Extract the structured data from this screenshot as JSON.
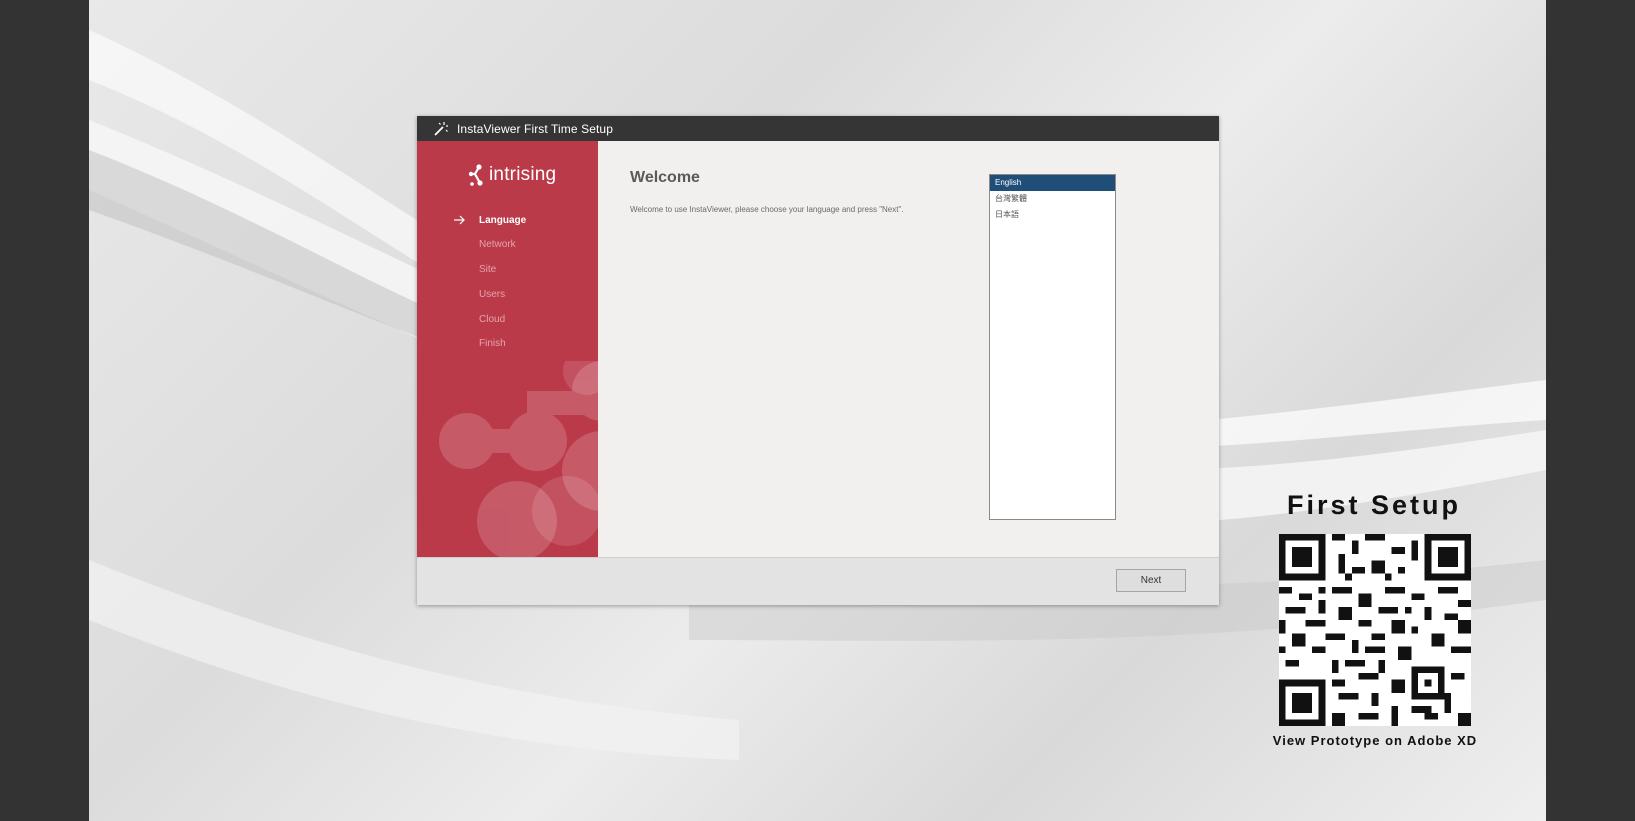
{
  "window": {
    "title": "InstaViewer First Time Setup",
    "app_icon": "magic-wand-icon"
  },
  "sidebar": {
    "brand": "intrising",
    "brand_icon": "intrising-logo-mark",
    "steps": [
      {
        "label": "Language",
        "active": true
      },
      {
        "label": "Network",
        "active": false
      },
      {
        "label": "Site",
        "active": false
      },
      {
        "label": "Users",
        "active": false
      },
      {
        "label": "Cloud",
        "active": false
      },
      {
        "label": "Finish",
        "active": false
      }
    ],
    "active_indicator_icon": "arrow-right-icon"
  },
  "content": {
    "heading": "Welcome",
    "description": "Welcome to use InstaViewer, please choose your language and press \"Next\".",
    "languages": [
      {
        "label": "English",
        "selected": true
      },
      {
        "label": "台灣繁體",
        "selected": false
      },
      {
        "label": "日本語",
        "selected": false
      }
    ]
  },
  "footer": {
    "next_label": "Next"
  },
  "promo": {
    "title": "First Setup",
    "caption": "View Prototype on Adobe XD",
    "qr_icon": "qr-code-icon"
  },
  "colors": {
    "sidebar": "#bb3a4a",
    "titlebar": "#353535",
    "selection": "#1f4e79",
    "outer_frame": "#333333"
  }
}
